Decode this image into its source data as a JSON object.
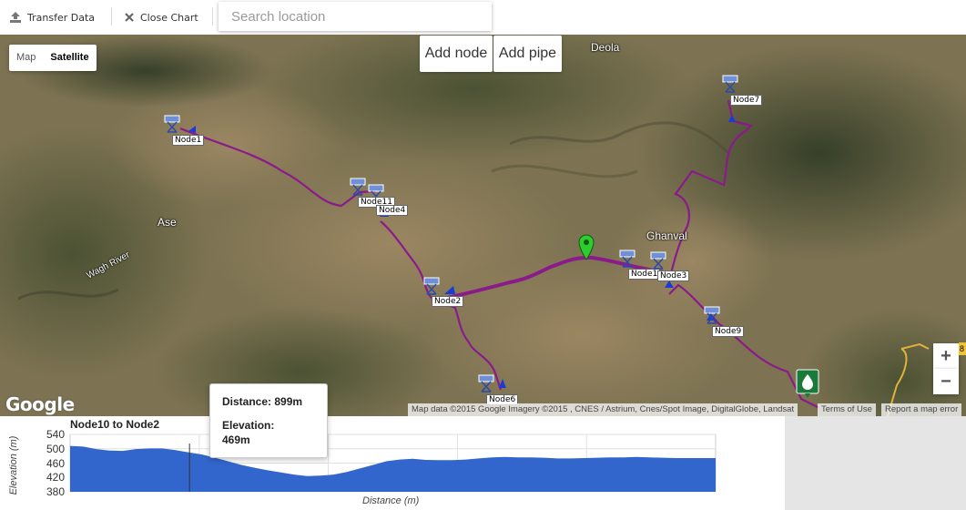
{
  "toolbar": {
    "transfer_label": "Transfer Data",
    "close_chart_label": "Close Chart",
    "search_placeholder": "Search location"
  },
  "map": {
    "map_type": {
      "map_label": "Map",
      "satellite_label": "Satellite",
      "selected": "Satellite"
    },
    "add_node_label": "Add node",
    "add_pipe_label": "Add pipe",
    "zoom_in_label": "+",
    "zoom_out_label": "−",
    "places": [
      "Deola",
      "Ase",
      "Ghanval"
    ],
    "river": "Wagh River",
    "google_logo": "Google",
    "attribution": "Map data ©2015 Google Imagery ©2015 , CNES / Astrium, Cnes/Spot Image, DigitalGlobe, Landsat",
    "terms": "Terms of Use",
    "report": "Report a map error",
    "edge_marker": "8",
    "nodes": [
      "Node1",
      "Node11",
      "Node4",
      "Node2",
      "Node6",
      "Node1",
      "Node3",
      "Node9",
      "Node7"
    ],
    "colors": {
      "pipe": "#8b1a8b",
      "selected_marker": "#2ecc2e",
      "tank_marker": "#1a7a3a",
      "node_icon": "#6f8fd6"
    }
  },
  "chart": {
    "title": "Node10 to Node2",
    "ylabel": "Elevation (m)",
    "xlabel": "Distance (m)",
    "tooltip": {
      "distance": "Distance: 899m",
      "elevation_label": "Elevation:",
      "elevation_value": "469m"
    }
  },
  "chart_data": {
    "type": "area",
    "title": "Node10 to Node2",
    "xlabel": "Distance (m)",
    "ylabel": "Elevation (m)",
    "ylim": [
      380,
      540
    ],
    "yticks": [
      540,
      500,
      460,
      420,
      380
    ],
    "grid": true,
    "series": [
      {
        "values": [
          508,
          506,
          499,
          495,
          494,
          499,
          501,
          501,
          496,
          490,
          484,
          475,
          465,
          455,
          447,
          440,
          434,
          428,
          424,
          425,
          428,
          435,
          445,
          455,
          465,
          470,
          472,
          469,
          468,
          468,
          470,
          473,
          476,
          477,
          476,
          476,
          475,
          473,
          473,
          474,
          475,
          476,
          476,
          477,
          476,
          475,
          474,
          474,
          474,
          474
        ],
        "color": "#3366cc"
      }
    ]
  }
}
